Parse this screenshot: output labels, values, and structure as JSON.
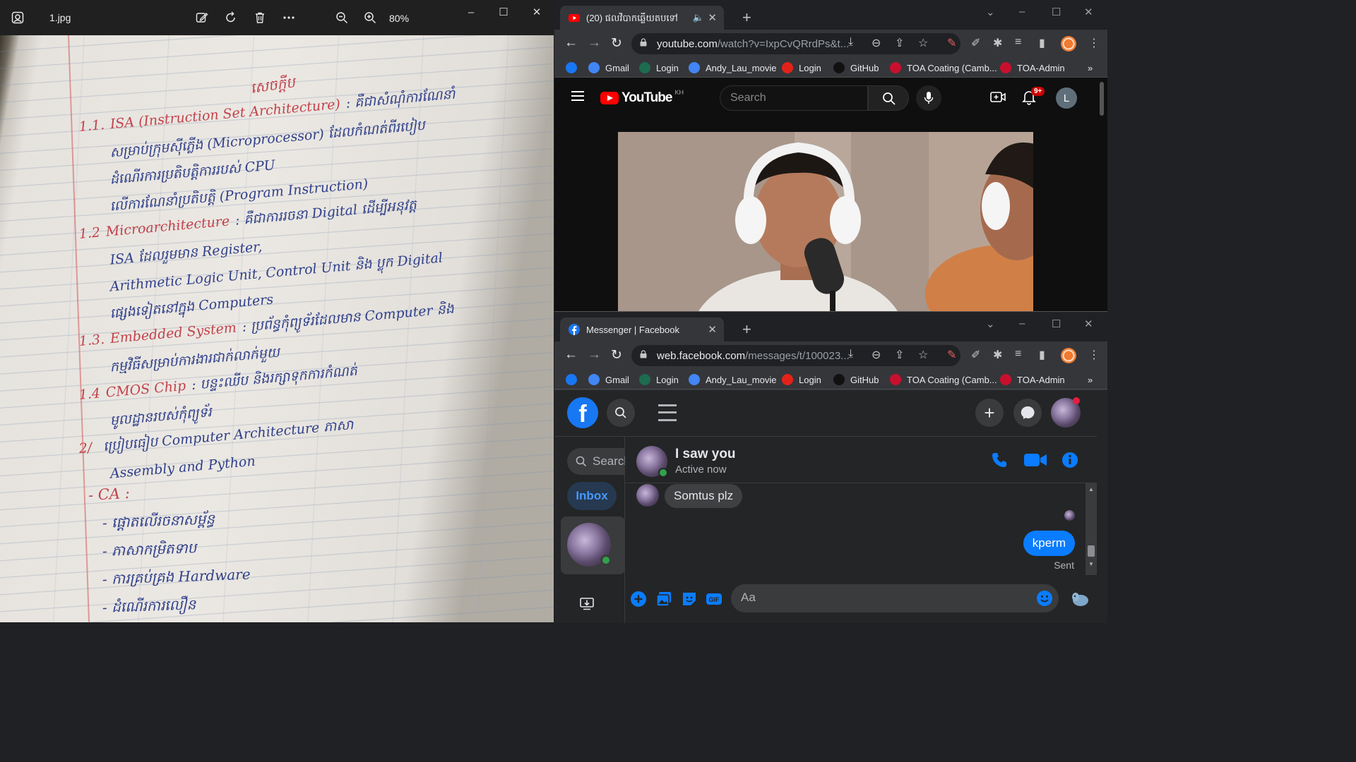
{
  "photos": {
    "filename": "1.jpg",
    "zoom": "80%",
    "icons": [
      "photos-app-icon",
      "edit-icon",
      "rotate-icon",
      "delete-icon",
      "more-icon",
      "zoom-out-icon",
      "zoom-in-icon"
    ],
    "handwriting": {
      "heading": "សេចក្តីប",
      "lines": [
        {
          "num": "1.1.",
          "term": "ISA (Instruction Set Architecture)",
          "rest": ": គឺជាសំណុំការណែនាំ"
        },
        {
          "num": "",
          "term": "",
          "rest": "សម្រាប់ក្រុមស៊ីភ្លើង (Microprocessor) ដែលកំណត់ពីរបៀប"
        },
        {
          "num": "",
          "term": "",
          "rest": "ដំណើរការប្រតិបត្តិការរបស់ CPU"
        },
        {
          "num": "",
          "term": "",
          "rest": "លើការណែនាំប្រតិបត្តិ (Program Instruction)"
        },
        {
          "num": "1.2",
          "term": "Microarchitecture",
          "rest": ": គឺជាការរចនា Digital ដើម្បីអនុវត្ត"
        },
        {
          "num": "",
          "term": "",
          "rest": "ISA ដែលរួមមាន Register,"
        },
        {
          "num": "",
          "term": "",
          "rest": "Arithmetic Logic Unit, Control Unit និង ប្លុក Digital"
        },
        {
          "num": "",
          "term": "",
          "rest": "ផ្សេងទៀតនៅក្នុង Computers"
        },
        {
          "num": "1.3.",
          "term": "Embedded System",
          "rest": ": ប្រព័ន្ធកុំព្យូទ័រដែលមាន Computer និង"
        },
        {
          "num": "",
          "term": "",
          "rest": "កម្មវិធីសម្រាប់ការងារជាក់លាក់មួយ"
        },
        {
          "num": "1.4",
          "term": "CMOS Chip",
          "rest": ": បន្ទះឈីប និងរក្សាទុកការកំណត់"
        },
        {
          "num": "",
          "term": "",
          "rest": "មូលដ្ឋានរបស់កុំព្យូទ័រ"
        },
        {
          "num": "2/",
          "term": "",
          "rest": "ប្រៀបធៀប Computer Architecture ភាសា"
        },
        {
          "num": "",
          "term": "",
          "rest": "Assembly and Python"
        }
      ],
      "list_header": "- CA :",
      "list_items": [
        "- ផ្តោតលើរចនាសម្ព័ន្ធ",
        "- ភាសាកម្រិតទាប",
        "- ការគ្រប់គ្រង Hardware",
        "- ដំណើរការលឿន"
      ]
    }
  },
  "window_controls": {
    "minimize": "–",
    "maximize": "☐",
    "close": "✕",
    "chevron": "⌄"
  },
  "youtube_window": {
    "tab_title": "(20) ផលវិបាកឆ្លើយតបទៅ",
    "url_main": "youtube.com",
    "url_rest": "/watch?v=IxpCvQRrdPs&t...",
    "bookmarks": [
      {
        "label": "",
        "icon": "facebook-bookmark-icon",
        "color": "#1877f2"
      },
      {
        "label": "Gmail",
        "icon": "google-icon",
        "color": "#4285f4"
      },
      {
        "label": "Login",
        "icon": "starbucks-icon",
        "color": "#1e6b4f"
      },
      {
        "label": "Andy_Lau_movie",
        "icon": "google-icon",
        "color": "#4285f4"
      },
      {
        "label": "Login",
        "icon": "seven-eleven-icon",
        "color": "#e2231a"
      },
      {
        "label": "GitHub",
        "icon": "github-icon",
        "color": "#111111"
      },
      {
        "label": "TOA Coating (Camb...",
        "icon": "toa-icon",
        "color": "#c8102e"
      },
      {
        "label": "TOA-Admin",
        "icon": "toa-icon",
        "color": "#c8102e"
      }
    ],
    "overflow": "»",
    "page": {
      "logo_text": "YouTube",
      "country": "KH",
      "search_placeholder": "Search",
      "notifications": "9+",
      "avatar_letter": "L"
    }
  },
  "messenger_window": {
    "tab_title": "Messenger | Facebook",
    "url_main": "web.facebook.com",
    "url_rest": "/messages/t/100023...",
    "search_placeholder": "Search",
    "inbox_label": "Inbox",
    "chat_name": "I saw you",
    "chat_status": "Active now",
    "incoming": "Somtus plz",
    "outgoing": "kperm",
    "sent_label": "Sent",
    "composer_placeholder": "Aa",
    "accent": "#0a7cff"
  }
}
